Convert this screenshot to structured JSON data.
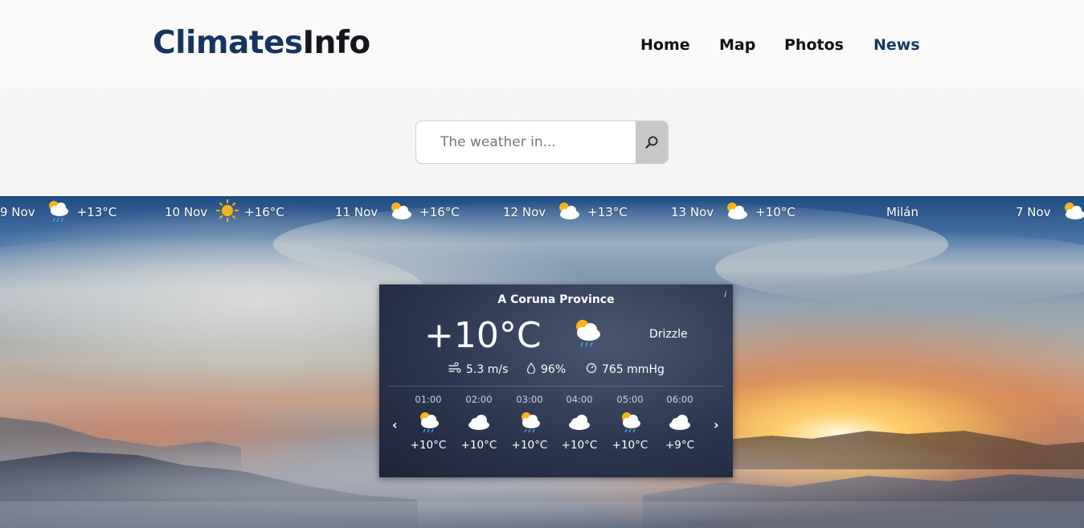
{
  "header": {
    "logo_part1": "Climates",
    "logo_part2": "Info",
    "nav": [
      "Home",
      "Map",
      "Photos",
      "News"
    ]
  },
  "search": {
    "placeholder": "The weather in..."
  },
  "forecast_strip": [
    {
      "date": "9 Nov",
      "icon": "sun-cloud-rain-icon",
      "temp": "+13°C"
    },
    {
      "date": "10 Nov",
      "icon": "sun-icon",
      "temp": "+16°C"
    },
    {
      "date": "11 Nov",
      "icon": "sun-cloud-icon",
      "temp": "+16°C"
    },
    {
      "date": "12 Nov",
      "icon": "sun-cloud-icon",
      "temp": "+13°C"
    },
    {
      "date": "13 Nov",
      "icon": "sun-cloud-icon",
      "temp": "+10°C"
    },
    {
      "city": "Milán"
    },
    {
      "date": "7 Nov",
      "icon": "sun-cloud-icon",
      "temp": ""
    }
  ],
  "widget": {
    "location": "A Coruna Province",
    "info": "i",
    "temperature": "+10°C",
    "condition": "Drizzle",
    "condition_icon": "sun-cloud-rain-icon",
    "wind": "5.3 m/s",
    "humidity": "96%",
    "pressure": "765 mmHg",
    "prev": "‹",
    "next": "›",
    "hourly": [
      {
        "time": "01:00",
        "icon": "sun-cloud-rain-icon",
        "temp": "+10°C"
      },
      {
        "time": "02:00",
        "icon": "cloud-icon",
        "temp": "+10°C"
      },
      {
        "time": "03:00",
        "icon": "sun-cloud-rain-icon",
        "temp": "+10°C"
      },
      {
        "time": "04:00",
        "icon": "cloud-icon",
        "temp": "+10°C"
      },
      {
        "time": "05:00",
        "icon": "sun-cloud-rain-icon",
        "temp": "+10°C"
      },
      {
        "time": "06:00",
        "icon": "cloud-icon",
        "temp": "+9°C"
      }
    ]
  }
}
